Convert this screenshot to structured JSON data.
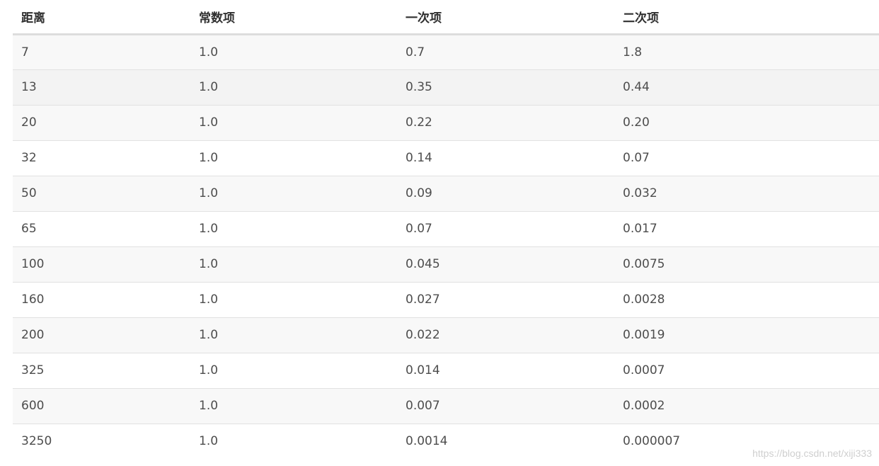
{
  "table": {
    "headers": [
      "距离",
      "常数项",
      "一次项",
      "二次项"
    ],
    "rows": [
      [
        "7",
        "1.0",
        "0.7",
        "1.8"
      ],
      [
        "13",
        "1.0",
        "0.35",
        "0.44"
      ],
      [
        "20",
        "1.0",
        "0.22",
        "0.20"
      ],
      [
        "32",
        "1.0",
        "0.14",
        "0.07"
      ],
      [
        "50",
        "1.0",
        "0.09",
        "0.032"
      ],
      [
        "65",
        "1.0",
        "0.07",
        "0.017"
      ],
      [
        "100",
        "1.0",
        "0.045",
        "0.0075"
      ],
      [
        "160",
        "1.0",
        "0.027",
        "0.0028"
      ],
      [
        "200",
        "1.0",
        "0.022",
        "0.0019"
      ],
      [
        "325",
        "1.0",
        "0.014",
        "0.0007"
      ],
      [
        "600",
        "1.0",
        "0.007",
        "0.0002"
      ],
      [
        "3250",
        "1.0",
        "0.0014",
        "0.000007"
      ]
    ]
  },
  "watermark": "https://blog.csdn.net/xiji333"
}
